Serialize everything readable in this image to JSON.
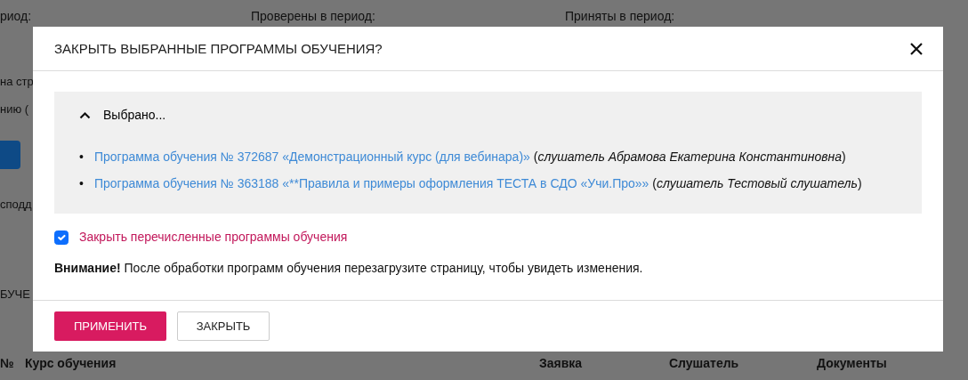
{
  "background": {
    "filters": [
      "риод:",
      "Проверены в период:",
      "Приняты в период:"
    ],
    "fragments": [
      "на стр",
      "нию ("
    ],
    "side_button": true,
    "fragment_lower": "сподд",
    "section_fragment": "БУЧЕ",
    "table_columns": [
      "№",
      "Курс обучения",
      "Заявка",
      "Слушатель",
      "Документы"
    ]
  },
  "modal": {
    "title": "ЗАКРЫТЬ ВЫБРАННЫЕ ПРОГРАММЫ ОБУЧЕНИЯ?",
    "selection": {
      "label": "Выбрано...",
      "expanded": true,
      "items": [
        {
          "marker": "•",
          "link": "Программа обучения № 372687 «Демонстрационный курс (для вебинара)»",
          "note": "(*слушатель Абрамова Екатерина Константиновна*)"
        },
        {
          "marker": "•",
          "link": "Программа обучения № 363188 «**Правила и примеры оформления ТЕСТА в СДО «Учи.Про»»",
          "note": "(*слушатель Тестовый слушатель*)"
        }
      ]
    },
    "confirm": {
      "label": "Закрыть перечисленные программы обучения",
      "checked": true
    },
    "warning": "**Внимание!** После обработки программ обучения перезагрузите страницу, чтобы увидеть изменения.",
    "buttons": [
      {
        "label": "ПРИМЕНИТЬ",
        "kind": "primary"
      },
      {
        "label": "ЗАКРЫТЬ",
        "kind": "secondary"
      }
    ]
  }
}
